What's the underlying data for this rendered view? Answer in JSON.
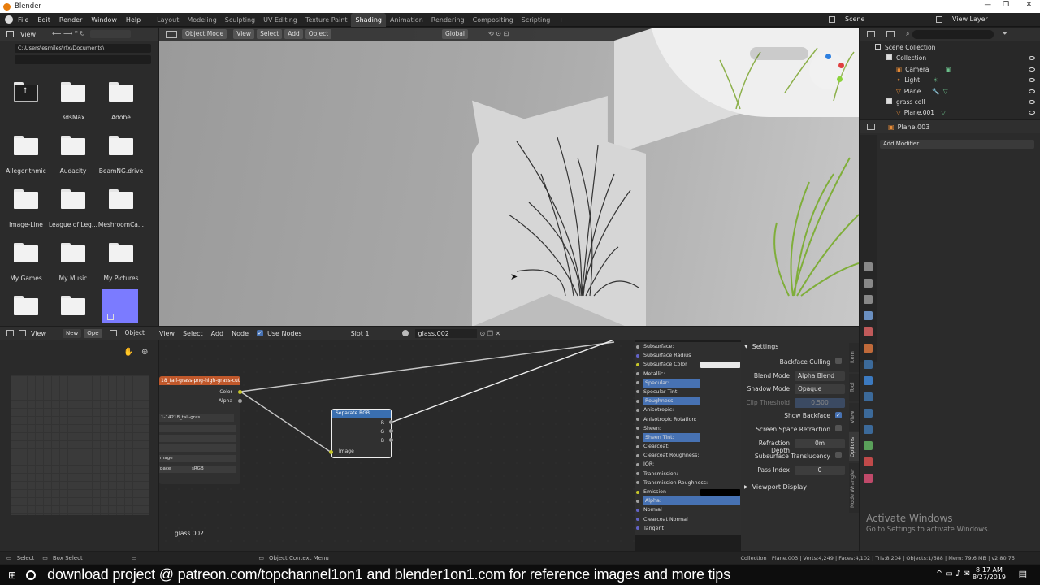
{
  "window": {
    "title": "Blender",
    "controls": [
      "—",
      "❐",
      "✕"
    ]
  },
  "menus": [
    "File",
    "Edit",
    "Render",
    "Window",
    "Help"
  ],
  "workspaces": [
    {
      "label": "Layout"
    },
    {
      "label": "Modeling"
    },
    {
      "label": "Sculpting"
    },
    {
      "label": "UV Editing"
    },
    {
      "label": "Texture Paint"
    },
    {
      "label": "Shading",
      "active": true
    },
    {
      "label": "Animation"
    },
    {
      "label": "Rendering"
    },
    {
      "label": "Compositing"
    },
    {
      "label": "Scripting"
    }
  ],
  "scene": {
    "name": "Scene",
    "view_layer": "View Layer"
  },
  "file_browser": {
    "view_label": "View",
    "path": "C:\\Users\\esmiles\\rfx\\Documents\\",
    "items": [
      "..",
      "3dsMax",
      "Adobe",
      "Allegorithmic",
      "Audacity",
      "BeamNG.drive",
      "Image-Line",
      "League of Leg...",
      "MeshroomCa...",
      "My Games",
      "My Music",
      "My Pictures",
      "",
      "",
      ""
    ]
  },
  "viewport": {
    "mode": "Object Mode",
    "menus": [
      "View",
      "Select",
      "Add",
      "Object"
    ],
    "orientation": "Global"
  },
  "node_editor": {
    "menus": [
      "View",
      "Select",
      "Add",
      "Node"
    ],
    "editor_label": "Object",
    "use_nodes": "Use Nodes",
    "slot": "Slot 1",
    "material": "glass.002",
    "new_label": "New",
    "open_label": "Ope",
    "image_node": {
      "title": "18_tall-grass-png-high-grass-cut-o...",
      "outputs": [
        "Color",
        "Alpha"
      ],
      "image_name": "1-14218_tall-gras...",
      "rows": [
        "",
        "",
        "",
        "mage",
        "pace"
      ],
      "colorspace": "sRGB"
    },
    "separate_rgb": {
      "title": "Separate RGB",
      "outputs": [
        "R",
        "G",
        "B"
      ],
      "input": "Image"
    },
    "material_label": "glass.002"
  },
  "bsdf_inputs": [
    {
      "label": "Subsurface:"
    },
    {
      "label": "Subsurface Radius"
    },
    {
      "label": "Subsurface Color",
      "swatch": "#e8e8e8"
    },
    {
      "label": "Metallic:"
    },
    {
      "label": "Specular:",
      "hl": true
    },
    {
      "label": "Specular Tint:"
    },
    {
      "label": "Roughness:",
      "hl": true
    },
    {
      "label": "Anisotropic:"
    },
    {
      "label": "Anisotropic Rotation:"
    },
    {
      "label": "Sheen:"
    },
    {
      "label": "Sheen Tint:",
      "hl": true
    },
    {
      "label": "Clearcoat:"
    },
    {
      "label": "Clearcoat Roughness:"
    },
    {
      "label": "IOR:"
    },
    {
      "label": "Transmission:"
    },
    {
      "label": "Transmission Roughness:"
    },
    {
      "label": "Emission",
      "swatch": "#000000"
    },
    {
      "label": "Alpha:",
      "hl2": true
    },
    {
      "label": "Normal"
    },
    {
      "label": "Clearcoat Normal"
    },
    {
      "label": "Tangent"
    }
  ],
  "settings": {
    "title": "Settings",
    "backface_culling": "Backface Culling",
    "blend_mode_label": "Blend Mode",
    "blend_mode": "Alpha Blend",
    "shadow_mode_label": "Shadow Mode",
    "shadow_mode": "Opaque",
    "clip_label": "Clip Threshold",
    "clip_value": "0.500",
    "show_backface": "Show Backface",
    "ssr": "Screen Space Refraction",
    "refraction_depth_label": "Refraction Depth",
    "refraction_depth": "0m",
    "sss_translucency": "Subsurface Translucency",
    "pass_index_label": "Pass Index",
    "pass_index": "0",
    "viewport_display": "Viewport Display"
  },
  "sidebar_tabs": [
    "Item",
    "Tool",
    "View",
    "Options",
    "Node Wrangler"
  ],
  "outliner": {
    "items": [
      {
        "label": "Scene Collection",
        "indent": 0
      },
      {
        "label": "Collection",
        "indent": 1
      },
      {
        "label": "Camera",
        "indent": 2
      },
      {
        "label": "Light",
        "indent": 2
      },
      {
        "label": "Plane",
        "indent": 2
      },
      {
        "label": "grass coll",
        "indent": 1
      },
      {
        "label": "Plane.001",
        "indent": 2
      }
    ]
  },
  "properties": {
    "object": "Plane.003",
    "add_modifier": "Add Modifier"
  },
  "activate": {
    "title": "Activate Windows",
    "sub": "Go to Settings to activate Windows."
  },
  "statusbar": {
    "select": "Select",
    "box_select": "Box Select",
    "context_menu": "Object Context Menu",
    "stats": "Collection | Plane.003 | Verts:4,249 | Faces:4,102 | Tris:8,204 | Objects:1/688 | Mem: 79.6 MB | v2.80.75"
  },
  "taskbar": {
    "banner": "download project @ patreon.com/topchannel1on1  and blender1on1.com for reference images and more tips",
    "time": "8:17 AM",
    "date": "8/27/2019"
  }
}
